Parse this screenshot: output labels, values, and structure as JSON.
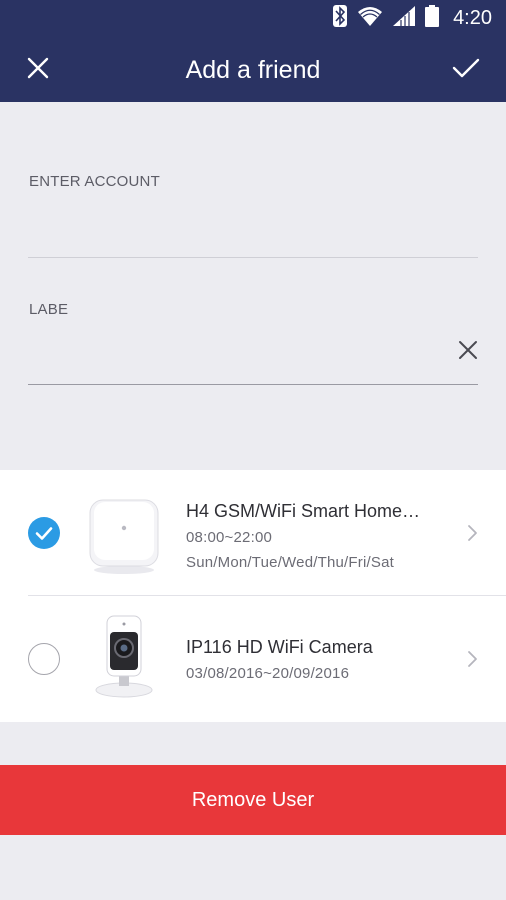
{
  "status_bar": {
    "time": "4:20",
    "icons": [
      "bluetooth-icon",
      "wifi-icon",
      "signal-icon",
      "battery-icon"
    ]
  },
  "toolbar": {
    "title": "Add a friend",
    "close_icon": "close-icon",
    "confirm_icon": "check-icon"
  },
  "form": {
    "account": {
      "label": "ENTER ACCOUNT",
      "value": ""
    },
    "label_field": {
      "label": "LABE",
      "value": "",
      "clear_icon": "clear-icon"
    }
  },
  "devices": [
    {
      "name": "H4 GSM/WiFi Smart Home…",
      "line1": "08:00~22:00",
      "line2": "Sun/Mon/Tue/Wed/Thu/Fri/Sat",
      "checked": true
    },
    {
      "name": "IP116 HD WiFi Camera",
      "line1": "03/08/2016~20/09/2016",
      "checked": false
    }
  ],
  "actions": {
    "remove_label": "Remove User"
  },
  "colors": {
    "header": "#2a3363",
    "accent": "#2b9be4",
    "danger": "#e8373a",
    "background": "#ececf1"
  }
}
